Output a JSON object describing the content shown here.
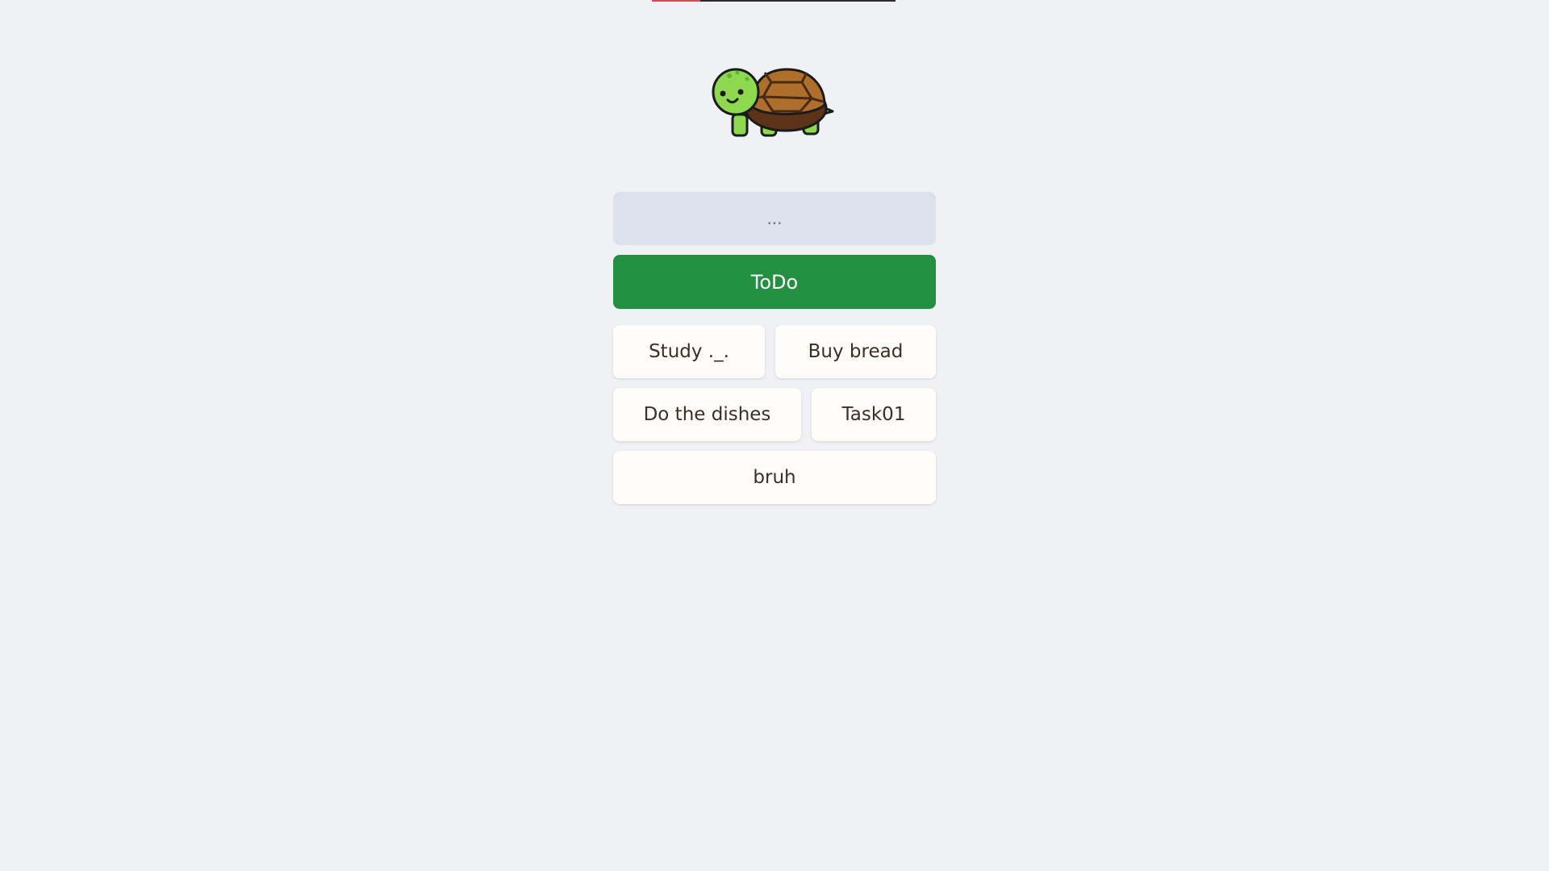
{
  "progress": {
    "fraction": 0.2,
    "fill_color": "#d94b5a",
    "track_color": "#2b2b2b"
  },
  "mascot": {
    "icon": "turtle-icon"
  },
  "input": {
    "placeholder": "...",
    "value": ""
  },
  "add_button": {
    "label": "ToDo",
    "color": "#228f41"
  },
  "tasks": [
    {
      "label": "Study ._."
    },
    {
      "label": "Buy bread"
    },
    {
      "label": "Do the dishes"
    },
    {
      "label": "Task01"
    },
    {
      "label": "bruh"
    }
  ]
}
